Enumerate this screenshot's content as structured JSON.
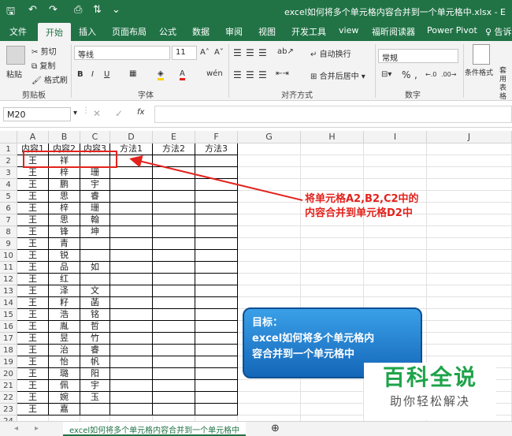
{
  "title": "excel如何将多个单元格内容合并到一个单元格中.xlsx - E",
  "quick_access": {
    "save": "save-icon",
    "undo": "undo-icon",
    "redo": "redo-icon",
    "preview": "print-preview-icon",
    "sort": "sort-icon"
  },
  "tabs": [
    "文件",
    "开始",
    "插入",
    "页面布局",
    "公式",
    "数据",
    "审阅",
    "视图",
    "开发工具",
    "view",
    "福昕阅读器",
    "Power Pivot",
    "♀ 告诉"
  ],
  "active_tab": 1,
  "ribbon": {
    "paste": "粘贴",
    "cut": "剪切",
    "copy": "复制",
    "format_painter": "格式刷",
    "clipboard": "剪贴板",
    "font_name": "等线",
    "font_size": "11",
    "bold": "B",
    "italic": "I",
    "underline": "U",
    "font_group": "字体",
    "wrap": "自动换行",
    "merge": "合并后居中",
    "align_group": "对齐方式",
    "number_format": "常规",
    "percent": "%",
    "comma": ",",
    "number_group": "数字",
    "cond_format": "条件格式",
    "table_format": "套用\n表格"
  },
  "name_box": "M20",
  "fx": "fx",
  "columns": [
    "A",
    "B",
    "C",
    "D",
    "E",
    "F",
    "G",
    "H",
    "I",
    "J"
  ],
  "rows": [
    "1",
    "2",
    "3",
    "4",
    "5",
    "6",
    "7",
    "8",
    "9",
    "10",
    "11",
    "12",
    "13",
    "14",
    "15",
    "16",
    "17",
    "18",
    "19",
    "20",
    "21",
    "22",
    "23",
    "24"
  ],
  "headers": [
    "内容1",
    "内容2",
    "内容3",
    "方法1",
    "方法2",
    "方法3"
  ],
  "data": [
    [
      "王",
      "祥",
      ""
    ],
    [
      "王",
      "梓",
      "珊"
    ],
    [
      "王",
      "鹏",
      "宇"
    ],
    [
      "王",
      "思",
      "睿"
    ],
    [
      "王",
      "梓",
      "珊"
    ],
    [
      "王",
      "思",
      "翰"
    ],
    [
      "王",
      "锋",
      "坤"
    ],
    [
      "王",
      "青",
      ""
    ],
    [
      "王",
      "锐",
      ""
    ],
    [
      "王",
      "品",
      "如"
    ],
    [
      "王",
      "红",
      ""
    ],
    [
      "王",
      "泽",
      "文"
    ],
    [
      "王",
      "籽",
      "菡"
    ],
    [
      "王",
      "浩",
      "铭"
    ],
    [
      "王",
      "胤",
      "哲"
    ],
    [
      "王",
      "昱",
      "竹"
    ],
    [
      "王",
      "治",
      "睿"
    ],
    [
      "王",
      "怡",
      "帆"
    ],
    [
      "王",
      "璐",
      "阳"
    ],
    [
      "王",
      "佩",
      "宇"
    ],
    [
      "王",
      "婉",
      "玉"
    ],
    [
      "王",
      "嘉",
      ""
    ]
  ],
  "annotation": [
    "将单元格A2,B2,C2中的",
    "内容合并到单元格D2中"
  ],
  "callout": [
    "目标：",
    "excel如何将多个单元格内",
    "容合并到一个单元格中"
  ],
  "watermark": {
    "main": "百科全说",
    "sub": "助你轻松解决"
  },
  "sheet_tab": "excel如何将多个单元格内容合并到一个单元格中",
  "add_sheet": "⊕",
  "colors": {
    "excel_green": "#217346",
    "annotation_red": "#e3221c",
    "callout_blue": "#1e7fd4"
  }
}
